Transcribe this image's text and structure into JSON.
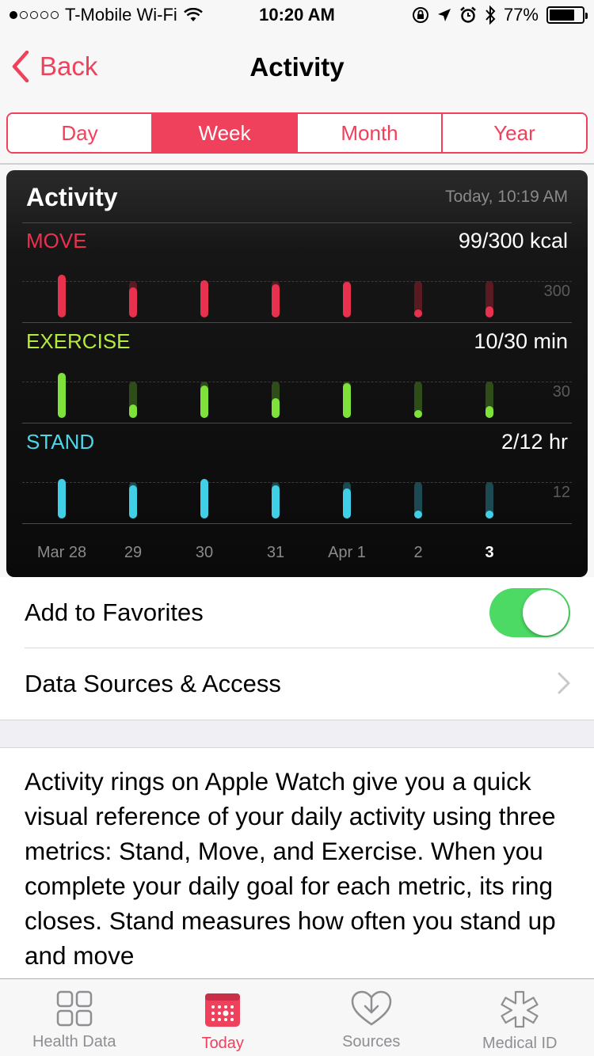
{
  "status_bar": {
    "carrier": "T-Mobile Wi-Fi",
    "time": "10:20 AM",
    "battery": "77%",
    "battery_level": 0.77
  },
  "nav": {
    "back_label": "Back",
    "title": "Activity"
  },
  "segments": [
    "Day",
    "Week",
    "Month",
    "Year"
  ],
  "selected_segment": "Week",
  "card": {
    "title": "Activity",
    "timestamp": "Today, 10:19 AM"
  },
  "chart_data": {
    "type": "bar",
    "categories": [
      "Mar 28",
      "29",
      "30",
      "31",
      "Apr 1",
      "2",
      "3"
    ],
    "highlighted_category": "3",
    "series": [
      {
        "name": "MOVE",
        "summary": "99/300 kcal",
        "goal_label": "300",
        "goal": 300,
        "color": "#e8314f",
        "values": [
          355,
          250,
          305,
          275,
          295,
          20,
          90
        ]
      },
      {
        "name": "EXERCISE",
        "summary": "10/30 min",
        "goal_label": "30",
        "goal": 30,
        "color": "#7ee23a",
        "values": [
          37,
          11,
          27,
          16,
          29,
          4,
          10
        ]
      },
      {
        "name": "STAND",
        "summary": "2/12 hr",
        "goal_label": "12",
        "goal": 12,
        "color": "#3fcfe6",
        "values": [
          13,
          11,
          13,
          11,
          10,
          1,
          2
        ]
      }
    ]
  },
  "list": {
    "favorites_label": "Add to Favorites",
    "favorites_on": true,
    "sources_label": "Data Sources & Access"
  },
  "description": "Activity rings on Apple Watch give you a quick visual reference of your daily activity using three metrics: Stand, Move, and Exercise. When you complete your daily goal for each metric, its ring closes. Stand measures how often you stand up and move",
  "tabs": [
    {
      "label": "Health Data",
      "icon": "health-data-icon"
    },
    {
      "label": "Today",
      "icon": "today-calendar-icon"
    },
    {
      "label": "Sources",
      "icon": "sources-heart-icon"
    },
    {
      "label": "Medical ID",
      "icon": "medical-id-icon"
    }
  ],
  "active_tab": "Today",
  "colors": {
    "accent": "#f0415c",
    "toggle_on": "#4cd964"
  }
}
